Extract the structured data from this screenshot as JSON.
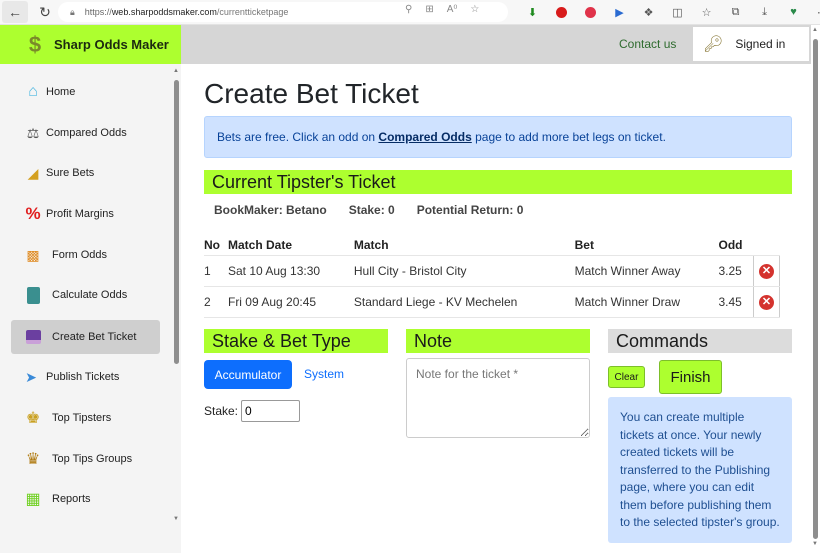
{
  "browser": {
    "url_scheme": "https://",
    "url_host": "web.sharpoddsmaker.com",
    "url_path": "/currentticketpage"
  },
  "header": {
    "brand": "Sharp Odds Maker",
    "contact": "Contact us",
    "signed_in": "Signed in"
  },
  "sidebar": {
    "items": [
      {
        "label": "Home",
        "icon": "home-icon"
      },
      {
        "label": "Compared Odds",
        "icon": "scales-icon"
      },
      {
        "label": "Sure Bets",
        "icon": "rising-bars-icon"
      },
      {
        "label": "Profit Margins",
        "icon": "percent-icon"
      },
      {
        "label": "Form Odds",
        "icon": "bar-chart-icon"
      },
      {
        "label": "Calculate Odds",
        "icon": "calculator-icon"
      },
      {
        "label": "Create Bet Ticket",
        "icon": "ticket-printer-icon",
        "active": true
      },
      {
        "label": "Publish Tickets",
        "icon": "paper-plane-icon"
      },
      {
        "label": "Top Tipsters",
        "icon": "crown-ball-icon"
      },
      {
        "label": "Top Tips Groups",
        "icon": "groups-crown-icon"
      },
      {
        "label": "Reports",
        "icon": "reports-icon"
      }
    ]
  },
  "main": {
    "title": "Create Bet Ticket",
    "alert": {
      "before": "Bets are free. Click an odd on ",
      "link": "Compared Odds",
      "after": " page to add more bet legs on ticket."
    },
    "ticket_heading": "Current Tipster's Ticket",
    "summary": {
      "bookmaker": "BookMaker: Betano",
      "stake": "Stake: 0",
      "potential_return": "Potential Return: 0"
    },
    "table": {
      "headers": [
        "No",
        "Match Date",
        "Match",
        "Bet",
        "Odd"
      ],
      "rows": [
        {
          "no": "1",
          "date": "Sat 10 Aug 13:30",
          "match": "Hull City - Bristol City",
          "bet": "Match Winner Away",
          "odd": "3.25"
        },
        {
          "no": "2",
          "date": "Fri 09 Aug 20:45",
          "match": "Standard Liege - KV Mechelen",
          "bet": "Match Winner Draw",
          "odd": "3.45"
        }
      ]
    },
    "stake_section": {
      "heading": "Stake & Bet Type",
      "accumulator": "Accumulator",
      "system": "System",
      "stake_label": "Stake:",
      "stake_value": "0"
    },
    "note_section": {
      "heading": "Note",
      "placeholder": "Note for the ticket *"
    },
    "commands": {
      "heading": "Commands",
      "clear": "Clear",
      "finish": "Finish",
      "info": "You can create multiple tickets at once. Your newly created tickets will be transferred to the Publishing page, where you can edit them before publishing them to the selected tipster's group."
    }
  },
  "colors": {
    "accent_green": "#adff2f",
    "primary_blue": "#0d6efd",
    "info_bg": "#cfe2ff",
    "delete_red": "#d4332e"
  }
}
